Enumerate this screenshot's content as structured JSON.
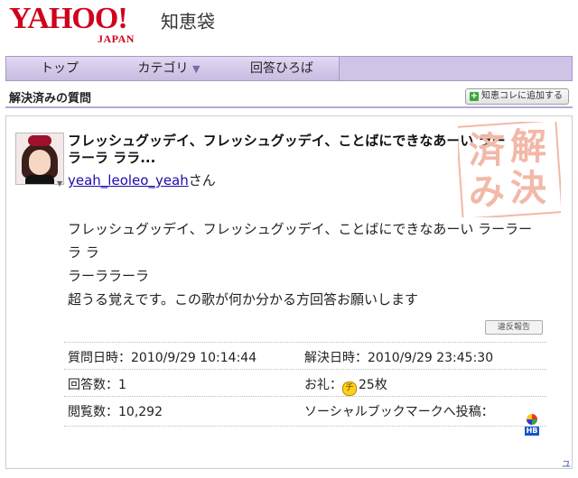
{
  "header": {
    "logo_main": "YAHOO!",
    "logo_japan": "JAPAN",
    "logo_service": "知恵袋"
  },
  "nav": {
    "tabs": [
      {
        "label": "トップ"
      },
      {
        "label": "カテゴリ"
      },
      {
        "label": "回答ひろば"
      }
    ]
  },
  "section": {
    "title": "解決済みの質問",
    "add_button": "知恵コレに追加する"
  },
  "question": {
    "title": "フレッシュグッデイ、フレッシュグッデイ、ことばにできなあーい ラーラーラ ララ...",
    "user_name": "yeah_leoleo_yeah",
    "user_suffix": "さん",
    "body_line1": "フレッシュグッデイ、フレッシュグッデイ、ことばにできなあーい ラーラーラ ラ",
    "body_line2": "ラーララーラ",
    "body_line3": "超うる覚えです。この歌が何か分かる方回答お願いします",
    "report_button": "違反報告",
    "stamp_chars": [
      "解",
      "決",
      "済",
      "み"
    ]
  },
  "info": {
    "asked_label": "質問日時：",
    "asked_value": "2010/9/29 10:14:44",
    "solved_label": "解決日時：",
    "solved_value": "2010/9/29 23:45:30",
    "answers_label": "回答数：",
    "answers_value": "1",
    "reward_label": "お礼：",
    "reward_coin": "チ",
    "reward_value": "25枚",
    "views_label": "閲覧数：",
    "views_value": "10,292",
    "social_label": "ソーシャルブックマークへ投稿："
  },
  "colors": {
    "brand": "#d0021b",
    "nav_bg": "#cfc3e6",
    "link": "#1a0dab",
    "stamp": "#f2b8a8"
  },
  "icons": {
    "add": "plus-icon",
    "reward": "chiebukuro-coin-icon",
    "social": "hatena-bookmark-icon"
  }
}
